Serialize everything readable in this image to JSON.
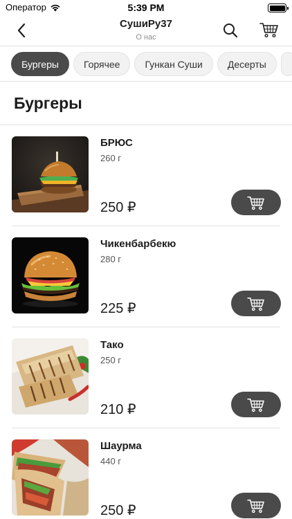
{
  "status_bar": {
    "carrier": "Оператор",
    "time": "5:39 PM",
    "battery_level": 1.0
  },
  "nav": {
    "title": "СушиРу37",
    "subtitle": "О нас"
  },
  "categories": [
    {
      "label": "Бургеры",
      "active": true
    },
    {
      "label": "Горячее",
      "active": false
    },
    {
      "label": "Гункан Суши",
      "active": false
    },
    {
      "label": "Десерты",
      "active": false
    }
  ],
  "section": {
    "title": "Бургеры"
  },
  "products": [
    {
      "name": "БРЮС",
      "weight": "260 г",
      "price": "250 ₽",
      "image": "burger-on-board"
    },
    {
      "name": "Чикенбарбекю",
      "weight": "280 г",
      "price": "225 ₽",
      "image": "chicken-burger"
    },
    {
      "name": "Тако",
      "weight": "250 г",
      "price": "210 ₽",
      "image": "grilled-wraps"
    },
    {
      "name": "Шаурма",
      "weight": "440 г",
      "price": "250 ₽",
      "image": "shawarma"
    }
  ],
  "colors": {
    "accent": "#4a4a4a",
    "background": "#ffffff",
    "divider": "#e0e0e0"
  }
}
